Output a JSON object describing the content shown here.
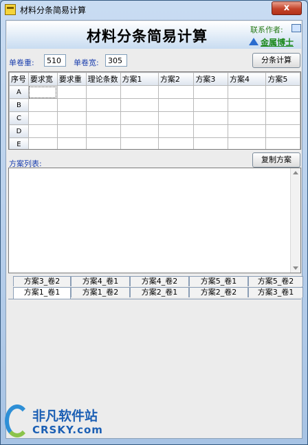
{
  "window": {
    "title": "材料分条简易计算",
    "close": "x"
  },
  "header": {
    "title": "材料分条简易计算",
    "contact_label": "联系作者:",
    "brand": "金属博士"
  },
  "params": {
    "weight_label": "单卷重:",
    "weight_value": "510",
    "width_label": "单卷宽:",
    "width_value": "305",
    "calc_button": "分条计算"
  },
  "table": {
    "headers": [
      "序号",
      "要求宽",
      "要求重",
      "理论条数",
      "方案1",
      "方案2",
      "方案3",
      "方案4",
      "方案5"
    ],
    "rows": [
      "A",
      "B",
      "C",
      "D",
      "E"
    ]
  },
  "list": {
    "label": "方案列表:",
    "copy_button": "复制方案"
  },
  "tabs": {
    "row1": [
      "方案3_卷2",
      "方案4_卷1",
      "方案4_卷2",
      "方案5_卷1",
      "方案5_卷2"
    ],
    "row2": [
      "方案1_卷1",
      "方案1_卷2",
      "方案2_卷1",
      "方案2_卷2",
      "方案3_卷1"
    ],
    "active": "方案1_卷1"
  },
  "watermark": {
    "cn": "非凡软件站",
    "en": "CRSKY.com"
  },
  "colors": {
    "label_blue": "#1b3fae",
    "brand_green": "#1f8a1f",
    "close_red": "#c4432a"
  }
}
